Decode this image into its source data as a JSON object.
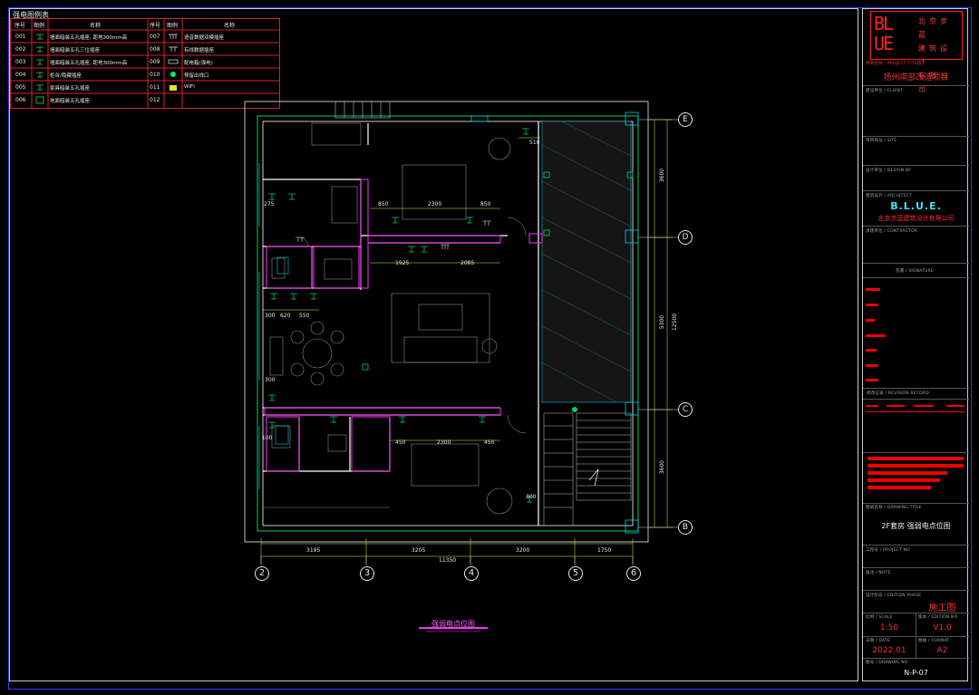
{
  "legend": {
    "title": "强电图例表",
    "headers": [
      "序号",
      "图例",
      "名称",
      "序号",
      "图例",
      "名称"
    ],
    "rows": [
      {
        "no_left": "001",
        "name_left": "墙面暗装五孔插座, 距地300mm高",
        "no_right": "007",
        "name_right": "语音数据双模插座"
      },
      {
        "no_left": "002",
        "name_left": "墙面暗装五孔三位插座",
        "no_right": "008",
        "name_right": "有线数据插座"
      },
      {
        "no_left": "003",
        "name_left": "墙面暗装五孔插座, 距地300mm高",
        "no_right": "009",
        "name_right": "配电箱(强电)"
      },
      {
        "no_left": "004",
        "name_left": "柜台/隐藏插座",
        "no_right": "010",
        "name_right": "预留出线口"
      },
      {
        "no_left": "005",
        "name_left": "家具暗装五孔插座",
        "no_right": "011",
        "name_right": "WIFI"
      },
      {
        "no_left": "006",
        "name_left": "地面暗装五孔插座",
        "no_right": "012",
        "name_right": ""
      }
    ]
  },
  "plan": {
    "dims_top": [
      "510",
      "850",
      "2300",
      "850",
      "275",
      "1925",
      "2085",
      "300",
      "620",
      "550",
      "300",
      "450",
      "2300",
      "450",
      "100",
      "300"
    ],
    "dims_bottom": [
      "3195",
      "3205",
      "3200",
      "1750"
    ],
    "dim_total": "11350",
    "dims_right": [
      "3600",
      "5300",
      "12500",
      "3600"
    ],
    "grid_cols": [
      "2",
      "3",
      "4",
      "5",
      "6"
    ],
    "grid_rows": [
      "E",
      "D",
      "C",
      "B"
    ],
    "drawing_caption": "强弱电点位图"
  },
  "title_block": {
    "logo_letters": [
      "B",
      "L",
      "U",
      "E"
    ],
    "logo_chars": [
      "北",
      "京",
      "步",
      "蓝",
      "建",
      "筑",
      "设",
      "计",
      "有",
      "限",
      "公",
      "司"
    ],
    "project_label": "项目名称 / PROJECT TITLE",
    "project_name": "扬州南部改造项目",
    "client_label": "建设单位 / CLIENT",
    "site_label": "项目地址 / SITE",
    "designed_label": "设计单位 / DESIGN BY",
    "arch_label": "建筑设计 / ARCHITECT",
    "company_brand": "B.L.U.E.",
    "company_name": "北京步蓝建筑设计有限公司",
    "contractor_label": "承建单位 / CONTRACTOR",
    "signature_label": "签署 / SIGNATURE",
    "revision_label": "修改记录 / REVISION RECORD",
    "drawing_title_label": "图纸名称 / DRAWING TITLE",
    "drawing_title": "2F套房 强弱电点位图",
    "project_no_label": "工程号 / PROJECT NO",
    "notes_label": "备注 / NOTE",
    "edition_label": "设计阶段 / EDITION PHASE",
    "edition": "施工图",
    "scale_label": "比例 / SCALE",
    "scale": "1:50",
    "version_label": "版本 / EDITION NO",
    "version": "V1.0",
    "date_label": "日期 / DATE",
    "date": "2022.01",
    "size_label": "图幅 / FORMAT",
    "size": "A2",
    "drawing_no_label": "图号 / DRAWING NO",
    "drawing_no": "N-P-07"
  },
  "colors": {
    "background": "#000000",
    "frame_blue": "#2b3cff",
    "legend_red": "#e0202a",
    "wall": "#ffffff",
    "dimension": "#c8ff40",
    "furniture": "#9a9a9a",
    "outline_cyan": "#00d0e0",
    "magenta": "#ff30ff",
    "green": "#00d060",
    "title_red": "#ff2020"
  }
}
